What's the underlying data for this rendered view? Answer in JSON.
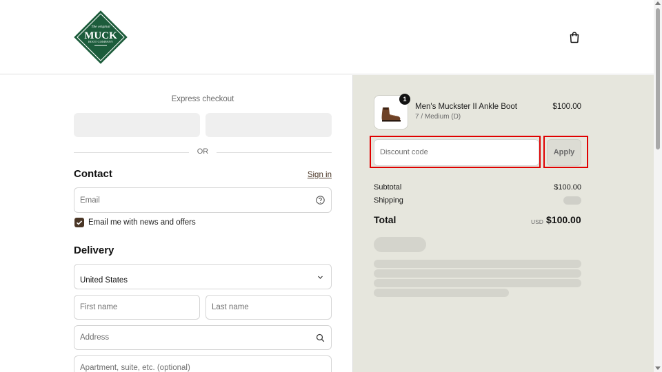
{
  "header": {
    "logo": {
      "small_text": "The original",
      "brand": "MUCK",
      "sub_text": "BOOT COMPANY",
      "color": "#1c5c3b"
    },
    "cart_icon": "shopping-bag-icon"
  },
  "express": {
    "title": "Express checkout",
    "or_label": "OR"
  },
  "contact": {
    "title": "Contact",
    "signin_label": "Sign in",
    "email_placeholder": "Email",
    "newsletter_label": "Email me with news and offers",
    "newsletter_checked": true
  },
  "delivery": {
    "title": "Delivery",
    "country_value": "United States",
    "first_name_placeholder": "First name",
    "last_name_placeholder": "Last name",
    "address_placeholder": "Address",
    "apartment_placeholder": "Apartment, suite, etc. (optional)"
  },
  "order": {
    "item": {
      "quantity": "1",
      "name": "Men's Muckster II Ankle Boot",
      "variant": "7 / Medium (D)",
      "price": "$100.00"
    },
    "discount_placeholder": "Discount code",
    "apply_label": "Apply",
    "subtotal_label": "Subtotal",
    "subtotal_value": "$100.00",
    "shipping_label": "Shipping",
    "total_label": "Total",
    "total_currency": "USD",
    "total_value": "$100.00"
  },
  "colors": {
    "accent": "#4a3626",
    "summary_bg": "#e6e6dd",
    "highlight": "#e00000"
  }
}
